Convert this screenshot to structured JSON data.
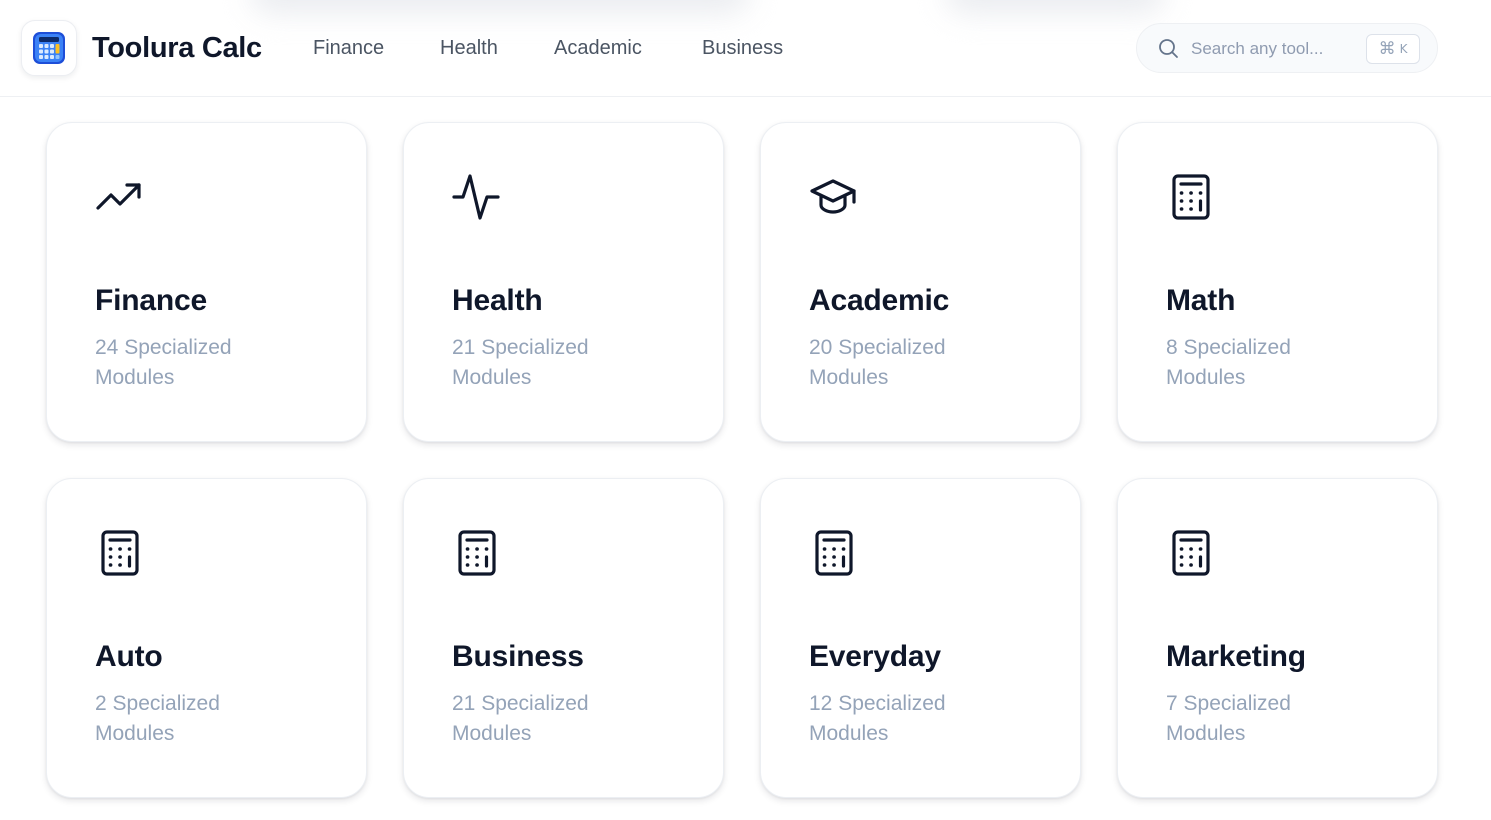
{
  "brand": {
    "name": "Toolura Calc"
  },
  "nav": [
    {
      "label": "Finance"
    },
    {
      "label": "Health"
    },
    {
      "label": "Academic"
    },
    {
      "label": "Business"
    }
  ],
  "search": {
    "placeholder": "Search any tool...",
    "shortcut_symbol": "⌘",
    "shortcut_key": "K"
  },
  "categories": [
    {
      "title": "Finance",
      "count": "24",
      "desc": "24 Specialized Modules",
      "icon": "trending-up-icon"
    },
    {
      "title": "Health",
      "count": "21",
      "desc": "21 Specialized Modules",
      "icon": "activity-icon"
    },
    {
      "title": "Academic",
      "count": "20",
      "desc": "20 Specialized Modules",
      "icon": "graduation-cap-icon"
    },
    {
      "title": "Math",
      "count": "8",
      "desc": "8 Specialized Modules",
      "icon": "calculator-icon"
    },
    {
      "title": "Auto",
      "count": "2",
      "desc": "2 Specialized Modules",
      "icon": "calculator-icon"
    },
    {
      "title": "Business",
      "count": "21",
      "desc": "21 Specialized Modules",
      "icon": "calculator-icon"
    },
    {
      "title": "Everyday",
      "count": "12",
      "desc": "12 Specialized Modules",
      "icon": "calculator-icon"
    },
    {
      "title": "Marketing",
      "count": "7",
      "desc": "7 Specialized Modules",
      "icon": "calculator-icon"
    }
  ],
  "colors": {
    "text_primary": "#0f172a",
    "text_muted": "#94a3b8",
    "nav_text": "#4b5563",
    "logo_blue": "#2563eb"
  }
}
